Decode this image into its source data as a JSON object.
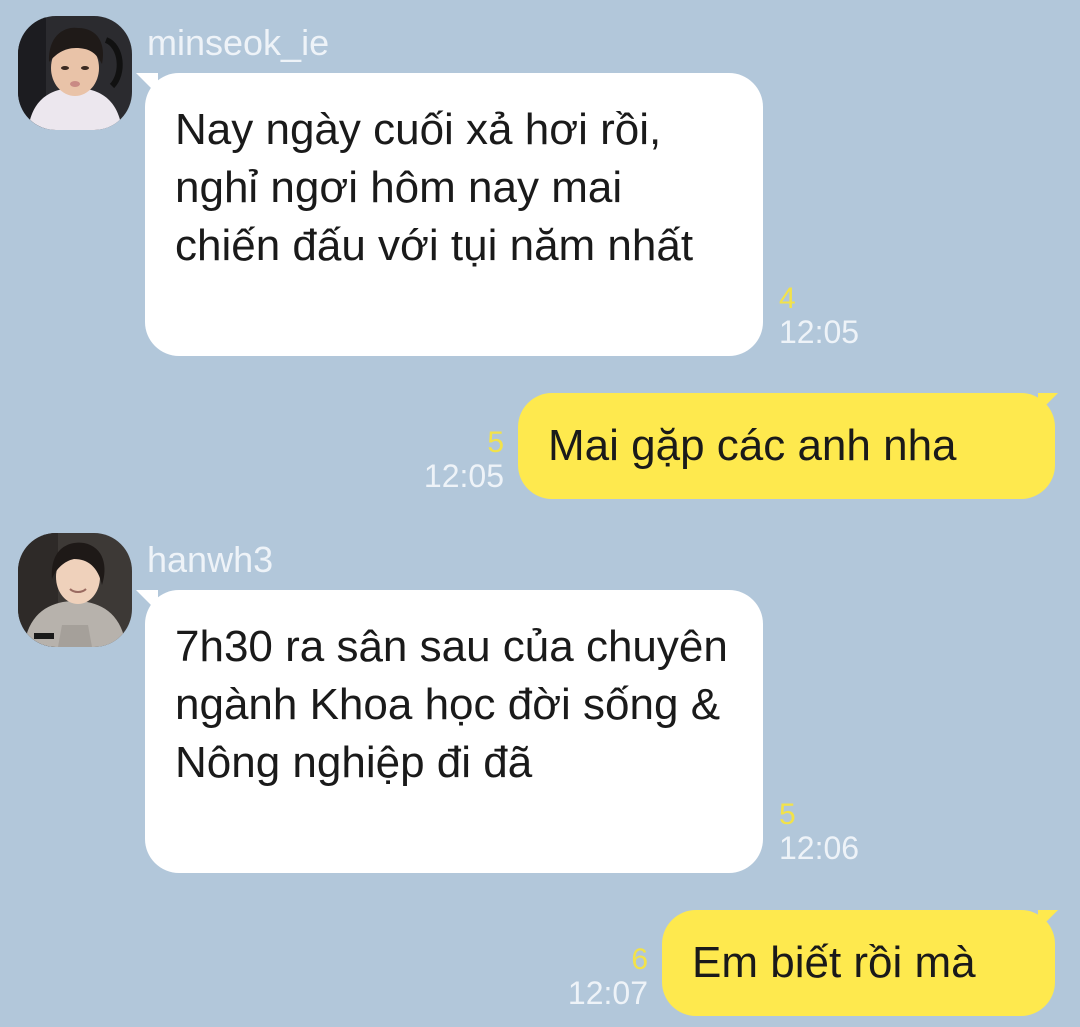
{
  "messages": [
    {
      "direction": "incoming",
      "sender": "minseok_ie",
      "avatar": "profile-photo",
      "text": "Nay ngày cuối xả hơi rồi, nghỉ ngơi hôm nay mai chiến đấu với tụi năm nhất",
      "unread_count": "4",
      "time": "12:05"
    },
    {
      "direction": "outgoing",
      "text": "Mai gặp các anh nha",
      "unread_count": "5",
      "time": "12:05"
    },
    {
      "direction": "incoming",
      "sender": "hanwh3",
      "avatar": "profile-photo",
      "text": "7h30 ra sân sau của chuyên ngành Khoa học đời sống & Nông nghiệp đi đã",
      "unread_count": "5",
      "time": "12:06"
    },
    {
      "direction": "outgoing",
      "text": "Em biết rồi mà",
      "unread_count": "6",
      "time": "12:07"
    }
  ],
  "colors": {
    "background": "#b2c7da",
    "incoming_bubble": "#ffffff",
    "outgoing_bubble": "#fee94e",
    "unread_count": "#f2e24a",
    "meta_text": "#eef3f8"
  }
}
